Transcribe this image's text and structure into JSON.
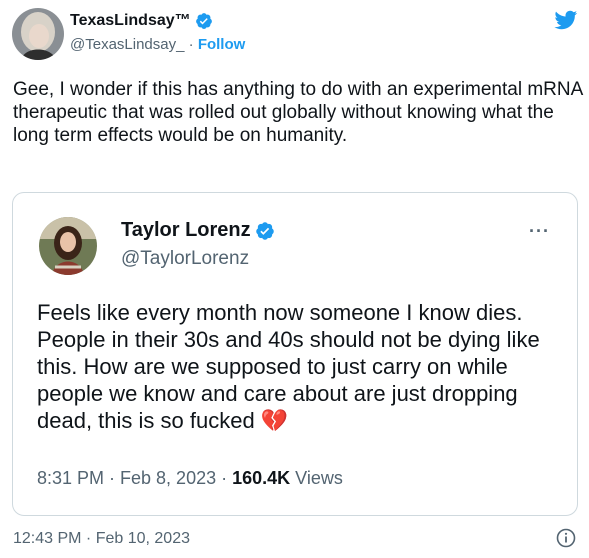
{
  "tweet": {
    "author_name": "TexasLindsay™",
    "author_handle": "@TexasLindsay_",
    "separator": "·",
    "follow_label": "Follow",
    "text": "Gee, I wonder if this has anything to do with an experimental mRNA therapeutic that was rolled out globally without knowing what the long term effects would be on humanity.",
    "timestamp": "12:43 PM · Feb 10, 2023"
  },
  "quoted": {
    "author_name": "Taylor Lorenz",
    "author_handle": "@TaylorLorenz",
    "more_label": "···",
    "text": "Feels like every month now someone I know dies. People in their 30s and 40s should not be dying like this. How are we supposed to just carry on while people we know and care about are just dropping dead, this is so fucked",
    "emoji": "💔",
    "time": "8:31 PM · Feb 8, 2023 · ",
    "views_count": "160.4K",
    "views_label": " Views"
  },
  "colors": {
    "brand_blue": "#1d9bf0",
    "secondary_text": "#536471",
    "border": "#cfd9de"
  },
  "icons": [
    "verified-badge-icon",
    "twitter-bird-icon",
    "more-dots-icon",
    "info-icon",
    "broken-heart-emoji"
  ]
}
